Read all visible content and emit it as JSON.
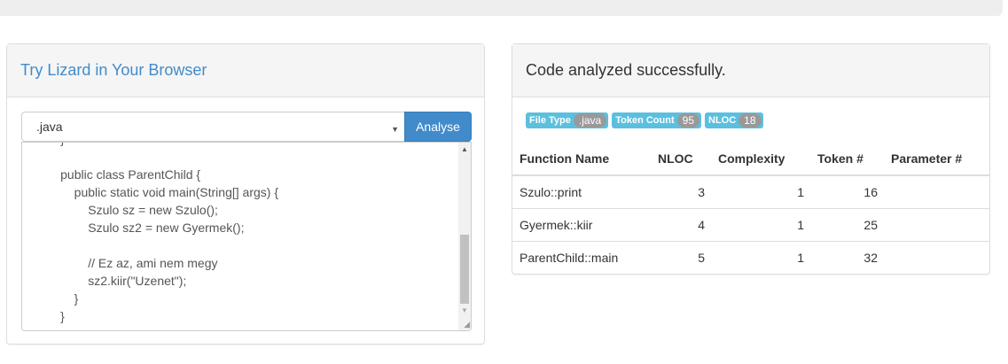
{
  "left_panel": {
    "title": "Try Lizard in Your Browser",
    "file_type": ".java",
    "analyse_label": "Analyse",
    "code_lines": [
      "        }",
      "",
      "        public class ParentChild {",
      "            public static void main(String[] args) {",
      "                Szulo sz = new Szulo();",
      "                Szulo sz2 = new Gyermek();",
      "",
      "                // Ez az, ami nem megy",
      "                sz2.kiir(\"Uzenet\");",
      "            }",
      "        }"
    ]
  },
  "right_panel": {
    "title": "Code analyzed successfully.",
    "badges": [
      {
        "label": "File Type",
        "value": ".java"
      },
      {
        "label": "Token Count",
        "value": "95"
      },
      {
        "label": "NLOC",
        "value": "18"
      }
    ],
    "table": {
      "headers": [
        "Function Name",
        "NLOC",
        "Complexity",
        "Token #",
        "Parameter #"
      ],
      "rows": [
        [
          "Szulo::print",
          "3",
          "1",
          "16",
          ""
        ],
        [
          "Gyermek::kiir",
          "4",
          "1",
          "25",
          ""
        ],
        [
          "ParentChild::main",
          "5",
          "1",
          "32",
          ""
        ]
      ]
    }
  }
}
